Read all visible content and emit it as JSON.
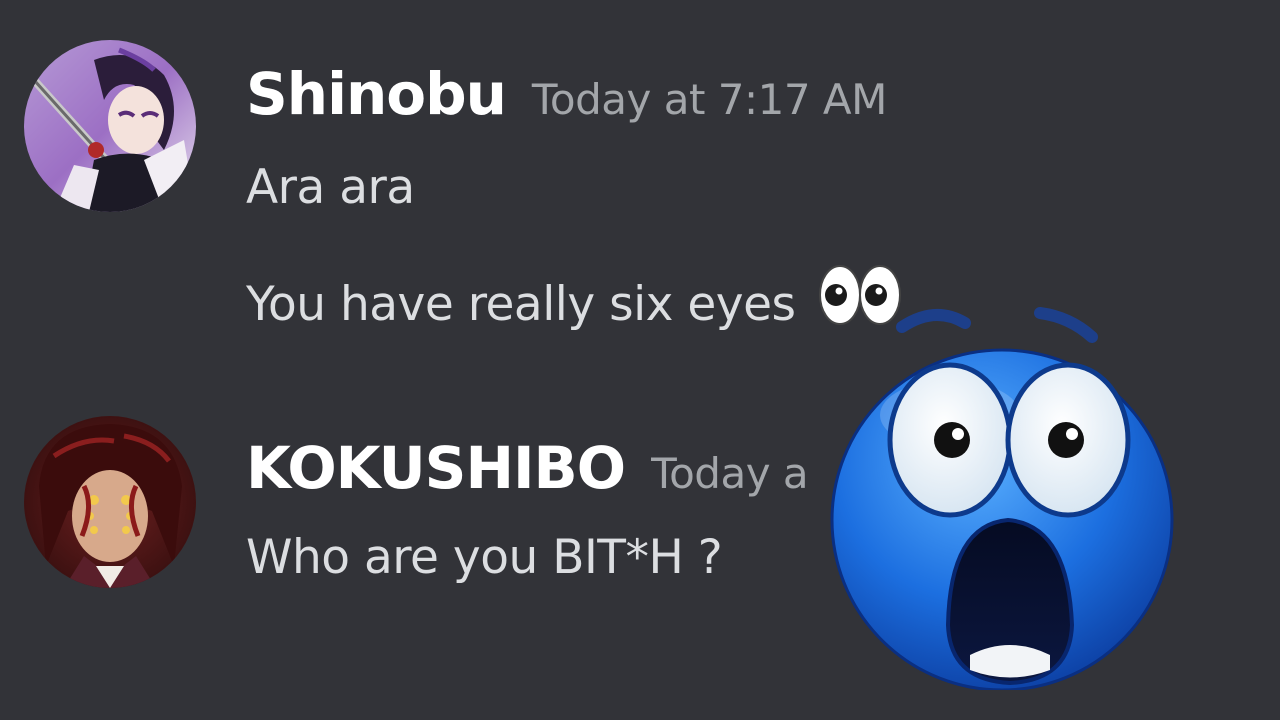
{
  "messages": [
    {
      "username": "Shinobu",
      "timestamp": "Today at 7:17 AM",
      "lines": [
        "Ara ara",
        "You have really six eyes"
      ],
      "emoji": "eyes-emoji"
    },
    {
      "username": "KOKUSHIBO",
      "timestamp": "Today a",
      "lines": [
        "Who are you BIT*H ?"
      ]
    }
  ],
  "overlay": {
    "sticker": "shocked-face-emoji"
  },
  "colors": {
    "background": "#323338",
    "username": "#ffffff",
    "timestamp": "#a3a6aa",
    "message_text": "#dcdee1",
    "sticker_blue": "#1e6fe0"
  }
}
